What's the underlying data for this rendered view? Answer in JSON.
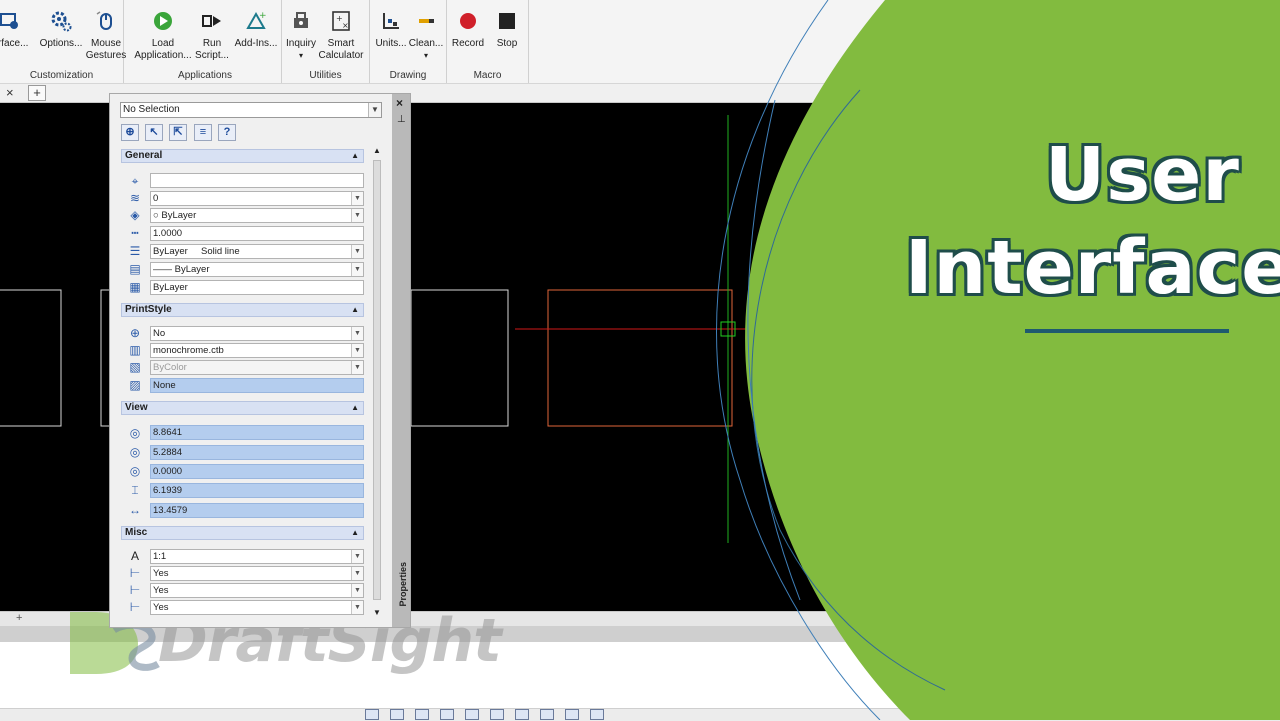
{
  "ribbon": {
    "groups": [
      {
        "label": "Customization",
        "buttons": [
          "Interface...",
          "Options...",
          "Mouse Gestures"
        ]
      },
      {
        "label": "Applications",
        "buttons": [
          "Load Application...",
          "Run Script...",
          "Add-Ins..."
        ]
      },
      {
        "label": "Utilities",
        "buttons": [
          "Inquiry",
          "Smart Calculator"
        ]
      },
      {
        "label": "Drawing",
        "buttons": [
          "Units...",
          "Clean..."
        ]
      },
      {
        "label": "Macro",
        "buttons": [
          "Record",
          "Stop"
        ]
      }
    ],
    "btn": {
      "interface": "terface...",
      "options": "Options...",
      "mouse1": "Mouse",
      "mouse2": "Gestures",
      "load1": "Load",
      "load2": "Application...",
      "run1": "Run",
      "run2": "Script...",
      "addins": "Add-Ins...",
      "inquiry": "Inquiry",
      "smart1": "Smart",
      "smart2": "Calculator",
      "units": "Units...",
      "clean": "Clean...",
      "record": "Record",
      "stop": "Stop"
    },
    "group_labels": {
      "customization": "Customization",
      "applications": "Applications",
      "utilities": "Utilities",
      "drawing": "Drawing",
      "macro": "Macro"
    }
  },
  "tabs": {
    "close": "×",
    "add": "+"
  },
  "properties": {
    "selection": "No Selection",
    "side_title": "Properties",
    "sections": {
      "general": "General",
      "printstyle": "PrintStyle",
      "view": "View",
      "misc": "Misc"
    },
    "general": {
      "color": "",
      "layer": "0",
      "color_bylayer": "ByLayer",
      "linescale": "1.0000",
      "linestyle": "ByLayer     Solid line",
      "lineweight": "—— ByLayer",
      "transparency": "ByLayer"
    },
    "printstyle": {
      "row1": "No",
      "row2": "monochrome.ctb",
      "row3": "ByColor",
      "row4": "None"
    },
    "view": {
      "center_x": "8.8641",
      "center_y": "5.2884",
      "center_z": "0.0000",
      "height": "6.1939",
      "width": "13.4579"
    },
    "misc": {
      "annotation_scale": "1:1",
      "ucs_icon_on": "Yes",
      "ucs_icon_origin": "Yes",
      "ucs_per_view": "Yes"
    }
  },
  "brand": {
    "title_line1": "User",
    "title_line2": "Interface",
    "logo": "DraftSight",
    "green": "#82bb3f",
    "rule_color": "#1e5a6f"
  }
}
